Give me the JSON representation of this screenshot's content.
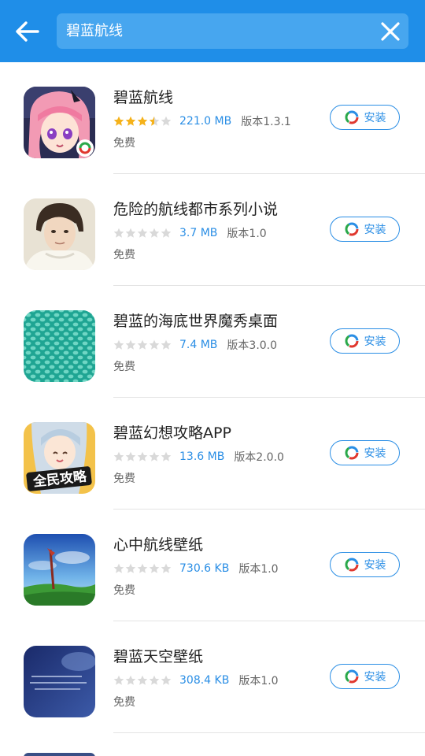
{
  "header": {
    "back_icon": "arrow-left-icon",
    "search_value": "碧蓝航线",
    "clear_icon": "close-icon",
    "bg_color": "#1f8ee8"
  },
  "colors": {
    "accent": "#2a8ee5",
    "star_filled": "#f5b21a",
    "star_empty": "#d9d9d9"
  },
  "results": [
    {
      "name": "碧蓝航线",
      "rating": 3.5,
      "size": "221.0 MB",
      "version": "版本1.3.1",
      "price": "免费",
      "install_label": "安装",
      "icon": "anime-girl-pink-hair-icon"
    },
    {
      "name": "危险的航线都市系列小说",
      "rating": 0,
      "size": "3.7 MB",
      "version": "版本1.0",
      "price": "免费",
      "install_label": "安装",
      "icon": "man-portrait-icon"
    },
    {
      "name": "碧蓝的海底世界魔秀桌面",
      "rating": 0,
      "size": "7.4 MB",
      "version": "版本3.0.0",
      "price": "免费",
      "install_label": "安装",
      "icon": "teal-pattern-icon"
    },
    {
      "name": "碧蓝幻想攻略APP",
      "rating": 0,
      "size": "13.6 MB",
      "version": "版本2.0.0",
      "price": "免费",
      "install_label": "安装",
      "icon": "anime-character-guide-icon",
      "icon_text": "全民攻略"
    },
    {
      "name": "心中航线壁纸",
      "rating": 0,
      "size": "730.6 KB",
      "version": "版本1.0",
      "price": "免费",
      "install_label": "安装",
      "icon": "sky-grass-wallpaper-icon"
    },
    {
      "name": "碧蓝天空壁纸",
      "rating": 0,
      "size": "308.4 KB",
      "version": "版本1.0",
      "price": "免费",
      "install_label": "安装",
      "icon": "night-sky-text-icon"
    }
  ]
}
